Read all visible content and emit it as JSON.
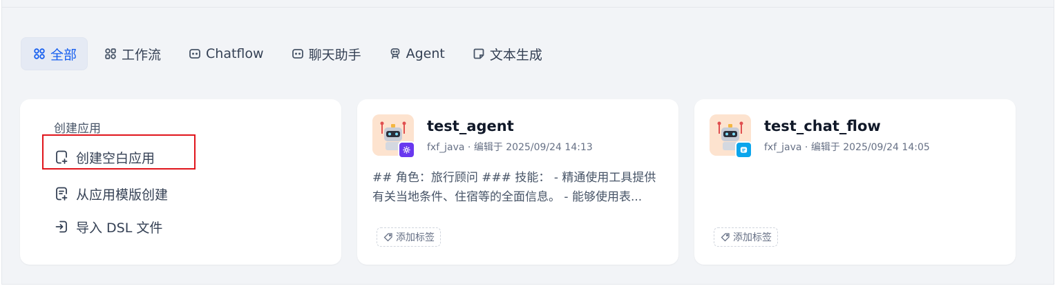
{
  "tabs": [
    {
      "label": "全部",
      "icon": "grid-icon",
      "active": true
    },
    {
      "label": "工作流",
      "icon": "workflow-icon",
      "active": false
    },
    {
      "label": "Chatflow",
      "icon": "chatflow-icon",
      "active": false
    },
    {
      "label": "聊天助手",
      "icon": "chat-assistant-icon",
      "active": false
    },
    {
      "label": "Agent",
      "icon": "agent-icon",
      "active": false
    },
    {
      "label": "文本生成",
      "icon": "text-generation-icon",
      "active": false
    }
  ],
  "create_card": {
    "title": "创建应用",
    "items": [
      {
        "label": "创建空白应用",
        "icon": "blank-file-plus-icon"
      },
      {
        "label": "从应用模版创建",
        "icon": "template-file-icon"
      },
      {
        "label": "导入 DSL 文件",
        "icon": "import-icon"
      }
    ]
  },
  "apps": [
    {
      "name": "test_agent",
      "meta": "fxf_java · 编辑于 2025/09/24 14:13",
      "description": "## 角色：旅行顾问 ### 技能： - 精通使用工具提供有关当地条件、住宿等的全面信息。 - 能够使用表...",
      "tag_label": "添加标签",
      "badge_color": "#6938ef",
      "badge_icon": "agent-badge-icon"
    },
    {
      "name": "test_chat_flow",
      "meta": "fxf_java · 编辑于 2025/09/24 14:05",
      "description": "",
      "tag_label": "添加标签",
      "badge_color": "#0ba5ec",
      "badge_icon": "chatflow-badge-icon"
    }
  ],
  "colors": {
    "accent": "#155eef",
    "highlight": "#e0131a",
    "background": "#f2f4f7"
  }
}
